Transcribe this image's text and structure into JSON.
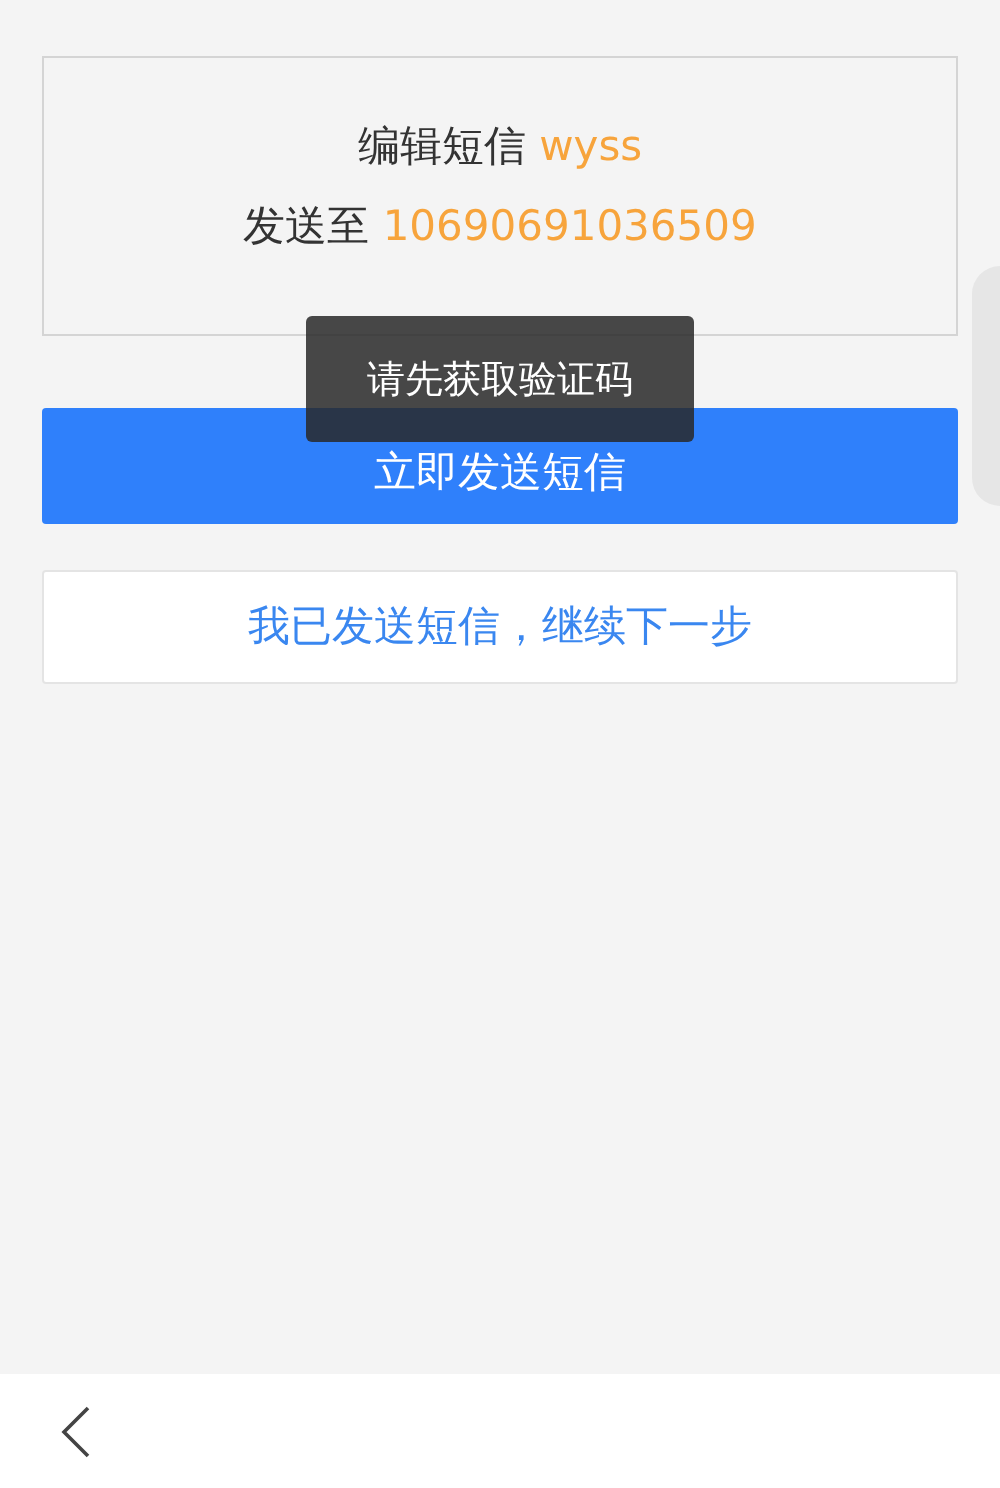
{
  "card": {
    "lines": [
      {
        "label": "编辑短信",
        "value": "wyss"
      },
      {
        "label": "发送至",
        "value": "10690691036509"
      }
    ]
  },
  "buttons": [
    {
      "kind": "primary",
      "label": "立即发送短信"
    },
    {
      "kind": "secondary",
      "label": "我已发送短信，继续下一步"
    }
  ],
  "toast": {
    "text": "请先获取验证码"
  }
}
